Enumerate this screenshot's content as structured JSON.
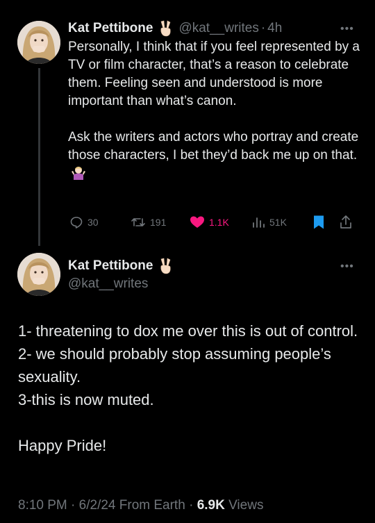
{
  "tweet1": {
    "author_name": "Kat Pettibone",
    "name_emoji": "peace-hand-emoji",
    "handle": "@kat__writes",
    "separator": "·",
    "time": "4h",
    "paragraph1": "Personally, I think that if you feel represented by a TV or film character, that’s a reason to celebrate them. Feeling seen and understood is more important than what’s canon.",
    "paragraph2": "Ask the writers and actors who portray and create those characters, I bet they’d back me up on that.",
    "paragraph2_emoji": "shrug-emoji",
    "stats": {
      "replies": "30",
      "reposts": "191",
      "likes": "1.1K",
      "views": "51K"
    },
    "like_color": "#f91880"
  },
  "tweet2": {
    "author_name": "Kat Pettibone",
    "name_emoji": "peace-hand-emoji",
    "handle": "@kat__writes",
    "lines": [
      "1- threatening to dox me over this is out of control.",
      "2- we should probably stop assuming people’s sexuality.",
      "3-this is now muted."
    ],
    "closing": "Happy Pride!",
    "meta": {
      "time": "8:10 PM",
      "sep1": " · ",
      "date": "6/2/24",
      "source": " From Earth",
      "sep2": " · ",
      "views_count": "6.9K",
      "views_label": " Views"
    }
  },
  "colors": {
    "background": "#000000",
    "text": "#e7e9ea",
    "muted": "#71767b",
    "bookmark": "#1d9bf0"
  }
}
